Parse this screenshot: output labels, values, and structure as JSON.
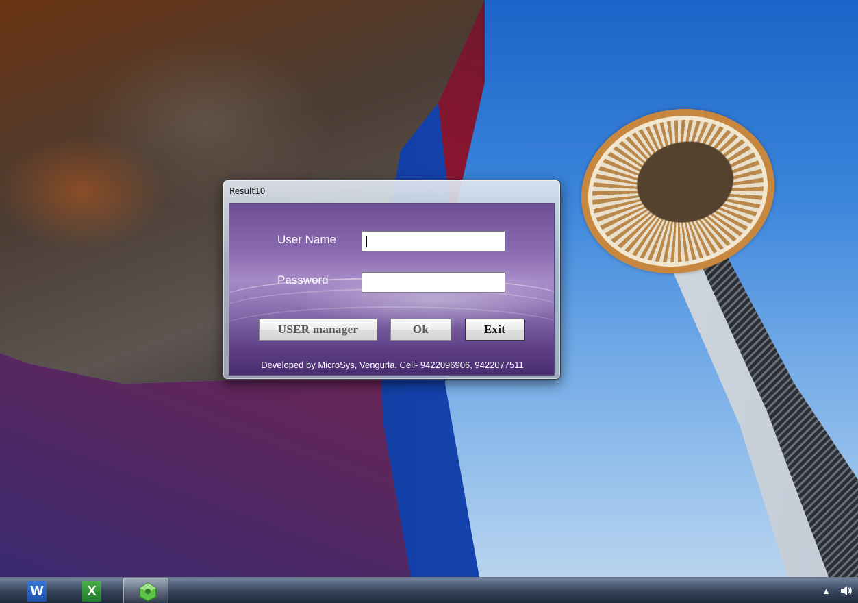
{
  "window": {
    "title": "Result10"
  },
  "form": {
    "username_label": "User Name",
    "username_value": "",
    "password_label": "Password",
    "password_value": "",
    "buttons": {
      "user_manager": "USER manager",
      "ok": "Ok",
      "ok_mnemonic": "O",
      "ok_rest": "k",
      "exit": "Exit",
      "exit_mnemonic": "E",
      "exit_rest": "xit"
    },
    "footer": "Developed by MicroSys, Vengurla. Cell- 9422096906, 9422077511"
  },
  "taskbar": {
    "items": [
      {
        "name": "word",
        "icon": "word-icon",
        "glyph": "W"
      },
      {
        "name": "excel",
        "icon": "excel-icon",
        "glyph": "X"
      },
      {
        "name": "result10",
        "icon": "app-icon",
        "active": true
      }
    ],
    "tray": {
      "show_hidden_icon": "up-arrow-icon",
      "volume_icon": "speaker-icon"
    }
  }
}
